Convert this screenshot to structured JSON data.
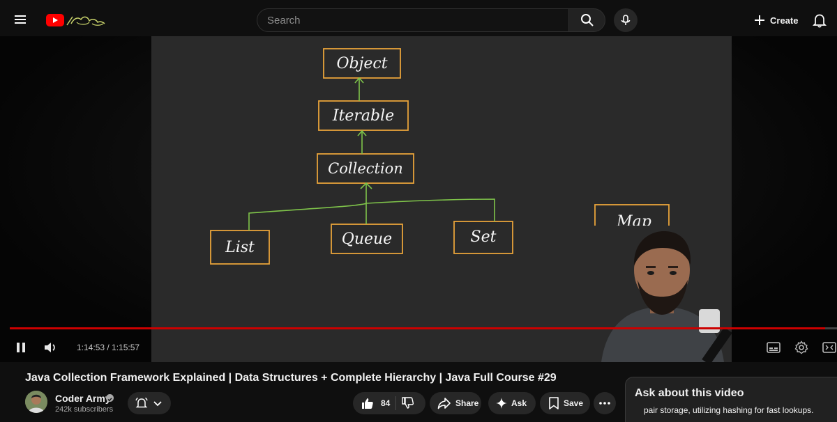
{
  "header": {
    "search_placeholder": "Search",
    "create_label": "Create"
  },
  "player": {
    "diagram": {
      "root": "Object",
      "level1": "Iterable",
      "level2": "Collection",
      "children": [
        "List",
        "Queue",
        "Set"
      ],
      "separate": "Map"
    },
    "time_current": "1:14:53",
    "time_total": "1:15:57",
    "time_display": "1:14:53 / 1:15:57",
    "progress_fraction": 0.986
  },
  "video": {
    "title": "Java Collection Framework Explained | Data Structures + Complete Hierarchy | Java Full Course #29"
  },
  "channel": {
    "name": "Coder Army",
    "subscribers": "242k subscribers"
  },
  "actions": {
    "likes": "84",
    "share_label": "Share",
    "ask_label": "Ask",
    "save_label": "Save"
  },
  "ask_panel": {
    "title": "Ask about this video",
    "snippet": "pair storage, utilizing hashing for fast lookups."
  },
  "colors": {
    "brand_red": "#ff0000",
    "diagram_box": "#e8a33a",
    "diagram_arrow": "#7fc44a",
    "board": "#2a2a2a"
  }
}
